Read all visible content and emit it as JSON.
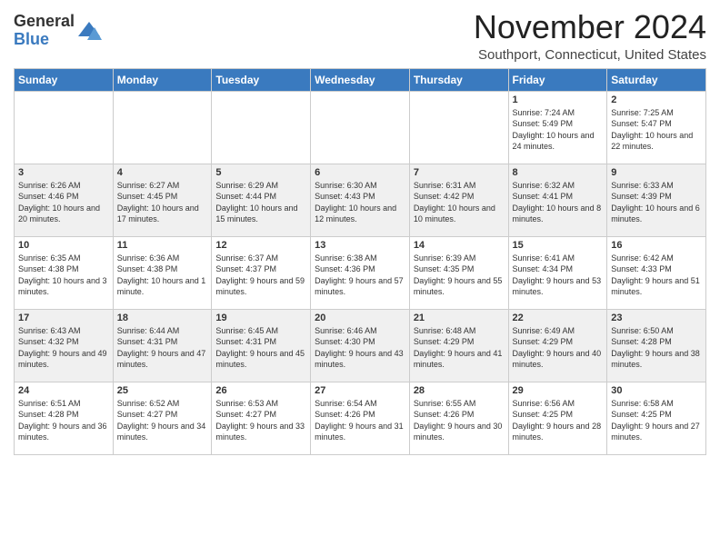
{
  "logo": {
    "general": "General",
    "blue": "Blue"
  },
  "title": "November 2024",
  "subtitle": "Southport, Connecticut, United States",
  "days_header": [
    "Sunday",
    "Monday",
    "Tuesday",
    "Wednesday",
    "Thursday",
    "Friday",
    "Saturday"
  ],
  "weeks": [
    [
      {
        "day": "",
        "info": ""
      },
      {
        "day": "",
        "info": ""
      },
      {
        "day": "",
        "info": ""
      },
      {
        "day": "",
        "info": ""
      },
      {
        "day": "",
        "info": ""
      },
      {
        "day": "1",
        "info": "Sunrise: 7:24 AM\nSunset: 5:49 PM\nDaylight: 10 hours and 24 minutes."
      },
      {
        "day": "2",
        "info": "Sunrise: 7:25 AM\nSunset: 5:47 PM\nDaylight: 10 hours and 22 minutes."
      }
    ],
    [
      {
        "day": "3",
        "info": "Sunrise: 6:26 AM\nSunset: 4:46 PM\nDaylight: 10 hours and 20 minutes."
      },
      {
        "day": "4",
        "info": "Sunrise: 6:27 AM\nSunset: 4:45 PM\nDaylight: 10 hours and 17 minutes."
      },
      {
        "day": "5",
        "info": "Sunrise: 6:29 AM\nSunset: 4:44 PM\nDaylight: 10 hours and 15 minutes."
      },
      {
        "day": "6",
        "info": "Sunrise: 6:30 AM\nSunset: 4:43 PM\nDaylight: 10 hours and 12 minutes."
      },
      {
        "day": "7",
        "info": "Sunrise: 6:31 AM\nSunset: 4:42 PM\nDaylight: 10 hours and 10 minutes."
      },
      {
        "day": "8",
        "info": "Sunrise: 6:32 AM\nSunset: 4:41 PM\nDaylight: 10 hours and 8 minutes."
      },
      {
        "day": "9",
        "info": "Sunrise: 6:33 AM\nSunset: 4:39 PM\nDaylight: 10 hours and 6 minutes."
      }
    ],
    [
      {
        "day": "10",
        "info": "Sunrise: 6:35 AM\nSunset: 4:38 PM\nDaylight: 10 hours and 3 minutes."
      },
      {
        "day": "11",
        "info": "Sunrise: 6:36 AM\nSunset: 4:38 PM\nDaylight: 10 hours and 1 minute."
      },
      {
        "day": "12",
        "info": "Sunrise: 6:37 AM\nSunset: 4:37 PM\nDaylight: 9 hours and 59 minutes."
      },
      {
        "day": "13",
        "info": "Sunrise: 6:38 AM\nSunset: 4:36 PM\nDaylight: 9 hours and 57 minutes."
      },
      {
        "day": "14",
        "info": "Sunrise: 6:39 AM\nSunset: 4:35 PM\nDaylight: 9 hours and 55 minutes."
      },
      {
        "day": "15",
        "info": "Sunrise: 6:41 AM\nSunset: 4:34 PM\nDaylight: 9 hours and 53 minutes."
      },
      {
        "day": "16",
        "info": "Sunrise: 6:42 AM\nSunset: 4:33 PM\nDaylight: 9 hours and 51 minutes."
      }
    ],
    [
      {
        "day": "17",
        "info": "Sunrise: 6:43 AM\nSunset: 4:32 PM\nDaylight: 9 hours and 49 minutes."
      },
      {
        "day": "18",
        "info": "Sunrise: 6:44 AM\nSunset: 4:31 PM\nDaylight: 9 hours and 47 minutes."
      },
      {
        "day": "19",
        "info": "Sunrise: 6:45 AM\nSunset: 4:31 PM\nDaylight: 9 hours and 45 minutes."
      },
      {
        "day": "20",
        "info": "Sunrise: 6:46 AM\nSunset: 4:30 PM\nDaylight: 9 hours and 43 minutes."
      },
      {
        "day": "21",
        "info": "Sunrise: 6:48 AM\nSunset: 4:29 PM\nDaylight: 9 hours and 41 minutes."
      },
      {
        "day": "22",
        "info": "Sunrise: 6:49 AM\nSunset: 4:29 PM\nDaylight: 9 hours and 40 minutes."
      },
      {
        "day": "23",
        "info": "Sunrise: 6:50 AM\nSunset: 4:28 PM\nDaylight: 9 hours and 38 minutes."
      }
    ],
    [
      {
        "day": "24",
        "info": "Sunrise: 6:51 AM\nSunset: 4:28 PM\nDaylight: 9 hours and 36 minutes."
      },
      {
        "day": "25",
        "info": "Sunrise: 6:52 AM\nSunset: 4:27 PM\nDaylight: 9 hours and 34 minutes."
      },
      {
        "day": "26",
        "info": "Sunrise: 6:53 AM\nSunset: 4:27 PM\nDaylight: 9 hours and 33 minutes."
      },
      {
        "day": "27",
        "info": "Sunrise: 6:54 AM\nSunset: 4:26 PM\nDaylight: 9 hours and 31 minutes."
      },
      {
        "day": "28",
        "info": "Sunrise: 6:55 AM\nSunset: 4:26 PM\nDaylight: 9 hours and 30 minutes."
      },
      {
        "day": "29",
        "info": "Sunrise: 6:56 AM\nSunset: 4:25 PM\nDaylight: 9 hours and 28 minutes."
      },
      {
        "day": "30",
        "info": "Sunrise: 6:58 AM\nSunset: 4:25 PM\nDaylight: 9 hours and 27 minutes."
      }
    ]
  ]
}
